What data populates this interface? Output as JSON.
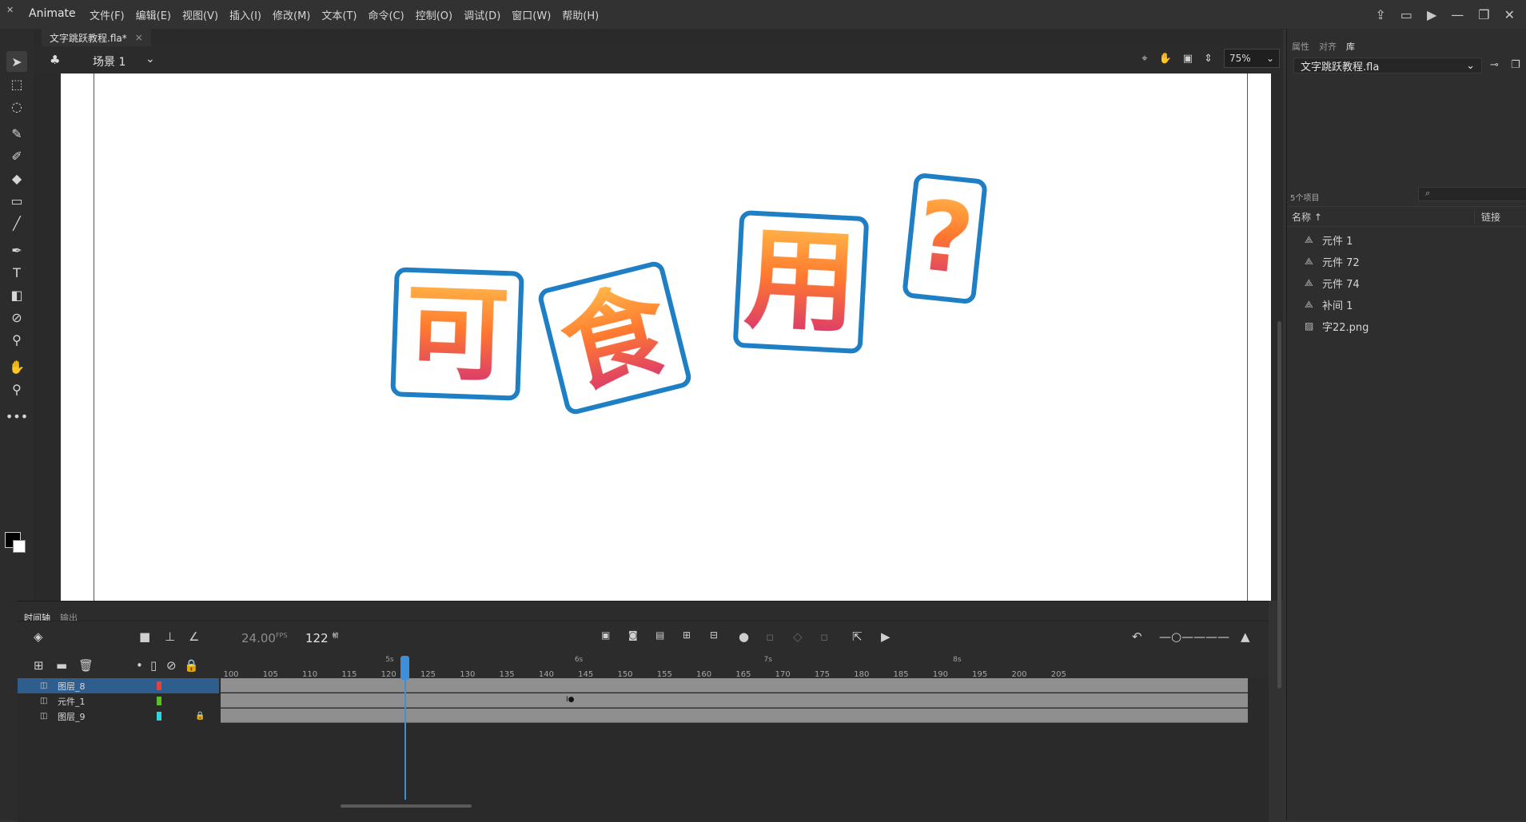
{
  "app": {
    "name": "Animate",
    "menus": [
      "文件(F)",
      "编辑(E)",
      "视图(V)",
      "插入(I)",
      "修改(M)",
      "文本(T)",
      "命令(C)",
      "控制(O)",
      "调试(D)",
      "窗口(W)",
      "帮助(H)"
    ]
  },
  "document": {
    "tab_title": "文字跳跃教程.fla*",
    "close_glyph": "×"
  },
  "scene": {
    "label": "场景 1",
    "zoom": "75%"
  },
  "artwork": {
    "chars": [
      "可",
      "食",
      "用",
      "?"
    ]
  },
  "timeline": {
    "tab_active": "时间轴",
    "tab_output": "输出",
    "fps": "24.00",
    "fps_unit": "FPS",
    "current_frame": "122",
    "frame_unit": "帧",
    "current_frame_value": 122,
    "seconds_labels": [
      "5s",
      "6s",
      "7s",
      "8s"
    ],
    "ruler": [
      "100",
      "105",
      "110",
      "115",
      "120",
      "125",
      "130",
      "135",
      "140",
      "145",
      "150",
      "155",
      "160",
      "165",
      "170",
      "175",
      "180",
      "185",
      "190",
      "195",
      "200",
      "205"
    ],
    "layers": [
      {
        "name": "图层_8",
        "color": "#e8413a",
        "selected": true,
        "locked": false
      },
      {
        "name": "元件_1",
        "color": "#5bbf2b",
        "selected": false,
        "locked": false
      },
      {
        "name": "图层_9",
        "color": "#2fd4dc",
        "selected": false,
        "locked": true
      }
    ]
  },
  "library": {
    "tabs": [
      "属性",
      "对齐",
      "库"
    ],
    "active_tab": "库",
    "file": "文字跳跃教程.fla",
    "item_count": "5个项目",
    "col_name": "名称 ↑",
    "col_link": "链接",
    "items": [
      {
        "label": "元件 1",
        "icon": "symbol-icon"
      },
      {
        "label": "元件 72",
        "icon": "symbol-icon"
      },
      {
        "label": "元件 74",
        "icon": "symbol-icon"
      },
      {
        "label": "补间 1",
        "icon": "symbol-icon"
      },
      {
        "label": "字22.png",
        "icon": "bitmap-icon"
      }
    ]
  }
}
